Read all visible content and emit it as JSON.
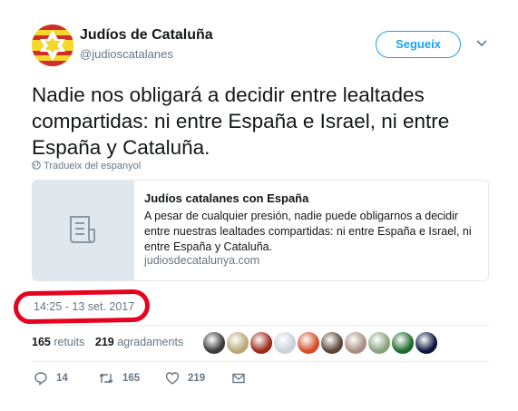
{
  "account": {
    "name": "Judíos de Cataluña",
    "handle": "@judioscatalanes",
    "avatar_colors": {
      "bg": "#f6d72a",
      "star": "#c8102e"
    }
  },
  "follow_button": {
    "label": "Segueix",
    "color": "#1da1f2"
  },
  "tweet": {
    "text": "Nadie nos obligará a decidir entre lealtades compartidas: ni entre España e Israel, ni entre España y Cataluña.",
    "translate_label": "Tradueix del espanyol"
  },
  "card": {
    "title": "Judíos catalanes con España",
    "description": "A pesar de cualquier presión, nadie puede obligarnos a decidir entre nuestras lealtades compartidas: ni entre España e Israel, ni entre España y Cataluña.",
    "domain": "judiosdecatalunya.com",
    "thumb_icon": "document-icon"
  },
  "timestamp": "14:25 - 13 set. 2017",
  "annotation_color": "#e8001c",
  "stats": {
    "retweets_count": "165",
    "retweets_label": "retuits",
    "likes_count": "219",
    "likes_label": "agradaments"
  },
  "likers": [
    {
      "name": "liker-1",
      "color": "#3a3a3a"
    },
    {
      "name": "liker-2",
      "color": "#b9a777"
    },
    {
      "name": "liker-3",
      "color": "#9c2a1a"
    },
    {
      "name": "liker-4",
      "color": "#c9d3da"
    },
    {
      "name": "liker-5",
      "color": "#d44d2a"
    },
    {
      "name": "liker-6",
      "color": "#5a4636"
    },
    {
      "name": "liker-7",
      "color": "#a88f82"
    },
    {
      "name": "liker-8",
      "color": "#8aa37e"
    },
    {
      "name": "liker-9",
      "color": "#1e6b2e"
    },
    {
      "name": "liker-10",
      "color": "#0a1640"
    }
  ],
  "actions": {
    "reply_count": "14",
    "retweet_count": "165",
    "like_count": "219"
  }
}
